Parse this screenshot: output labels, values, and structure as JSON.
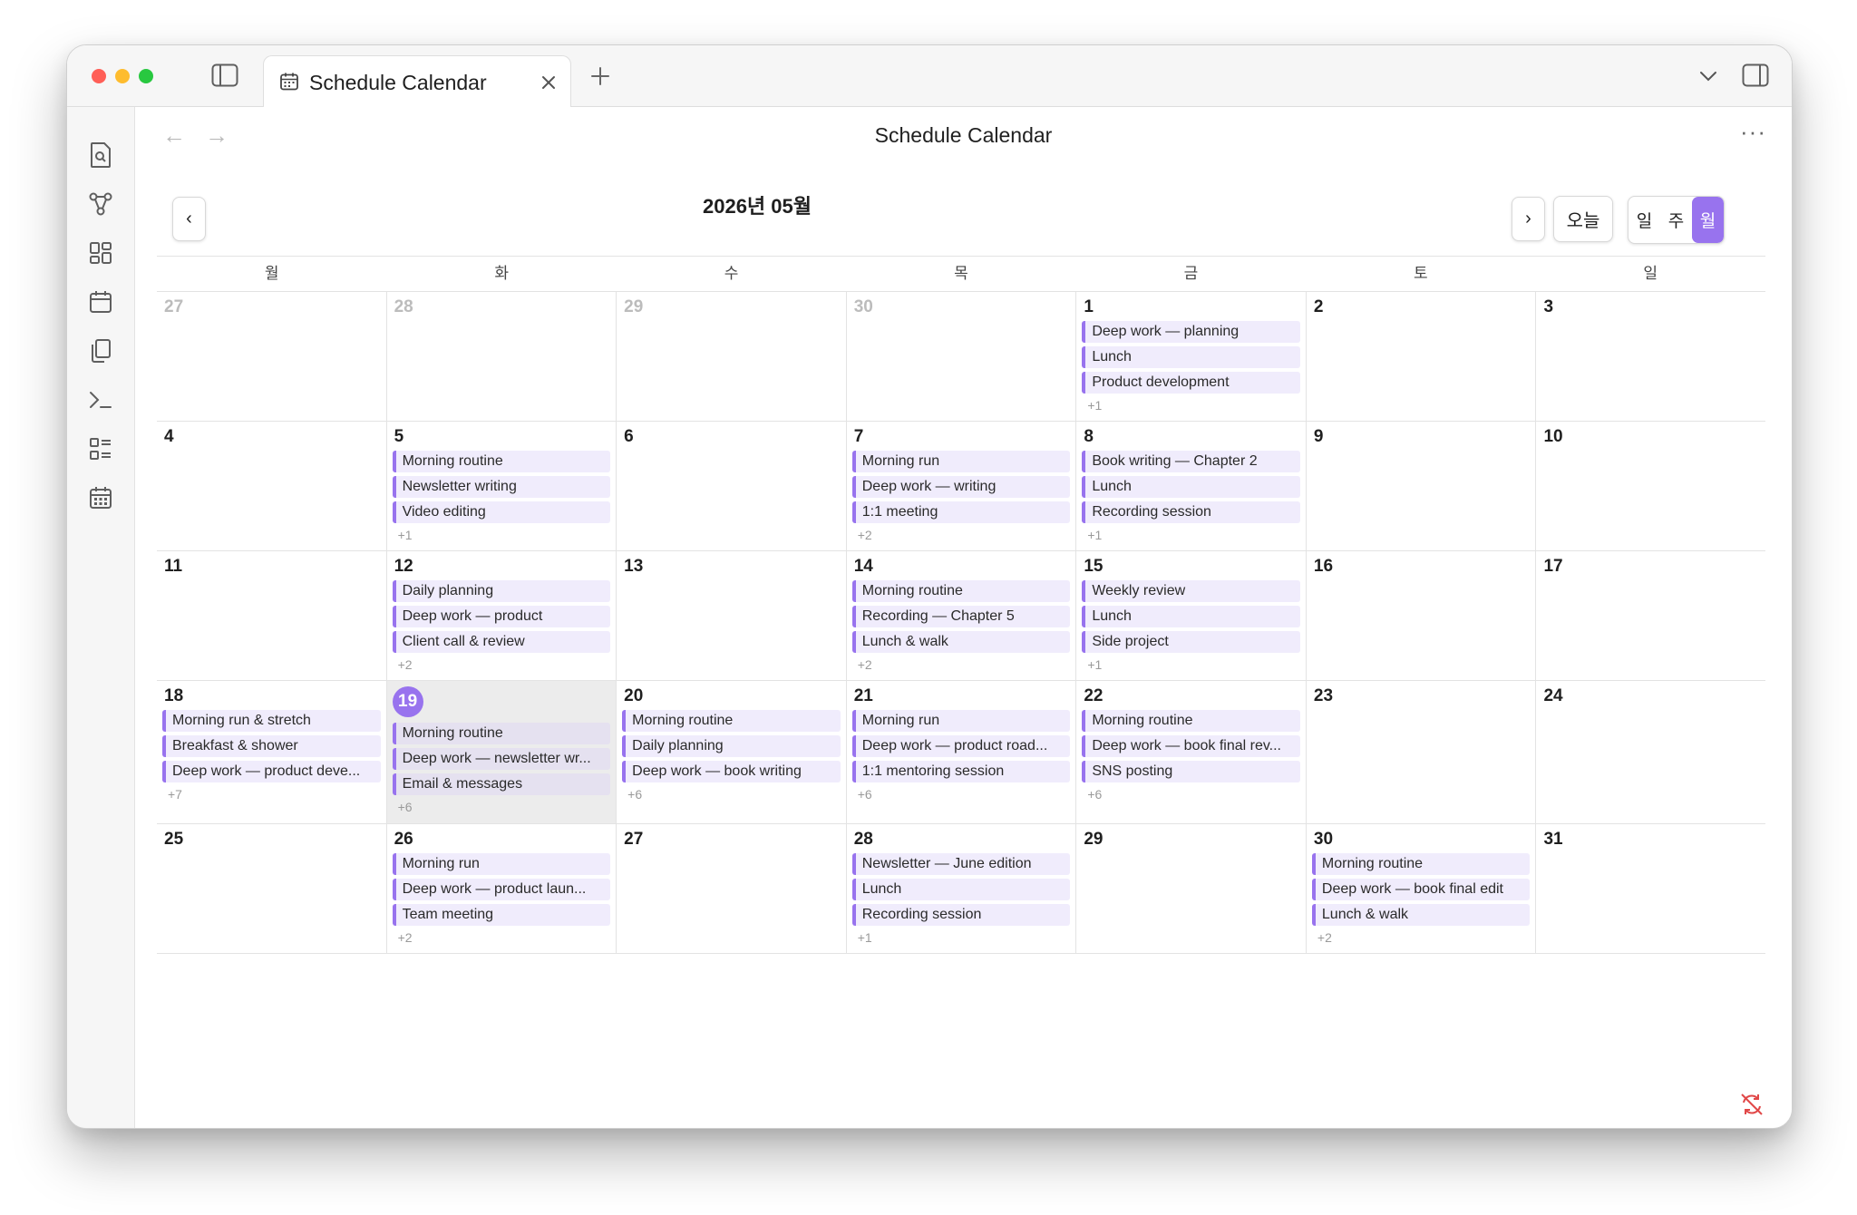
{
  "tab": {
    "title": "Schedule Calendar"
  },
  "page": {
    "title": "Schedule Calendar"
  },
  "calendar": {
    "month_label": "2026년 05월",
    "today_label": "오늘",
    "view_options": [
      "일",
      "주",
      "월"
    ],
    "active_view": "월",
    "accent_color": "#9873ee",
    "weekdays": [
      "월",
      "화",
      "수",
      "목",
      "금",
      "토",
      "일"
    ],
    "weeks": [
      [
        {
          "day": "27",
          "muted": true,
          "events": [],
          "more": ""
        },
        {
          "day": "28",
          "muted": true,
          "events": [],
          "more": ""
        },
        {
          "day": "29",
          "muted": true,
          "events": [],
          "more": ""
        },
        {
          "day": "30",
          "muted": true,
          "events": [],
          "more": ""
        },
        {
          "day": "1",
          "events": [
            "Deep work — planning",
            "Lunch",
            "Product development"
          ],
          "more": "+1"
        },
        {
          "day": "2",
          "events": [],
          "more": ""
        },
        {
          "day": "3",
          "events": [],
          "more": ""
        }
      ],
      [
        {
          "day": "4",
          "events": [],
          "more": ""
        },
        {
          "day": "5",
          "events": [
            "Morning routine",
            "Newsletter writing",
            "Video editing"
          ],
          "more": "+1"
        },
        {
          "day": "6",
          "events": [],
          "more": ""
        },
        {
          "day": "7",
          "events": [
            "Morning run",
            "Deep work — writing",
            "1:1 meeting"
          ],
          "more": "+2"
        },
        {
          "day": "8",
          "events": [
            "Book writing — Chapter 2",
            "Lunch",
            "Recording session"
          ],
          "more": "+1"
        },
        {
          "day": "9",
          "events": [],
          "more": ""
        },
        {
          "day": "10",
          "events": [],
          "more": ""
        }
      ],
      [
        {
          "day": "11",
          "events": [],
          "more": ""
        },
        {
          "day": "12",
          "events": [
            "Daily planning",
            "Deep work — product",
            "Client call & review"
          ],
          "more": "+2"
        },
        {
          "day": "13",
          "events": [],
          "more": ""
        },
        {
          "day": "14",
          "events": [
            "Morning routine",
            "Recording — Chapter 5",
            "Lunch & walk"
          ],
          "more": "+2"
        },
        {
          "day": "15",
          "events": [
            "Weekly review",
            "Lunch",
            "Side project"
          ],
          "more": "+1"
        },
        {
          "day": "16",
          "events": [],
          "more": ""
        },
        {
          "day": "17",
          "events": [],
          "more": ""
        }
      ],
      [
        {
          "day": "18",
          "events": [
            "Morning run & stretch",
            "Breakfast & shower",
            "Deep work — product deve..."
          ],
          "more": "+7"
        },
        {
          "day": "19",
          "today": true,
          "events": [
            "Morning routine",
            "Deep work — newsletter wr...",
            "Email & messages"
          ],
          "more": "+6"
        },
        {
          "day": "20",
          "events": [
            "Morning routine",
            "Daily planning",
            "Deep work — book writing"
          ],
          "more": "+6"
        },
        {
          "day": "21",
          "events": [
            "Morning run",
            "Deep work — product road...",
            "1:1 mentoring session"
          ],
          "more": "+6"
        },
        {
          "day": "22",
          "events": [
            "Morning routine",
            "Deep work — book final rev...",
            "SNS posting"
          ],
          "more": "+6"
        },
        {
          "day": "23",
          "events": [],
          "more": ""
        },
        {
          "day": "24",
          "events": [],
          "more": ""
        }
      ],
      [
        {
          "day": "25",
          "events": [],
          "more": ""
        },
        {
          "day": "26",
          "events": [
            "Morning run",
            "Deep work — product laun...",
            "Team meeting"
          ],
          "more": "+2"
        },
        {
          "day": "27",
          "events": [],
          "more": ""
        },
        {
          "day": "28",
          "events": [
            "Newsletter — June edition",
            "Lunch",
            "Recording session"
          ],
          "more": "+1"
        },
        {
          "day": "29",
          "events": [],
          "more": ""
        },
        {
          "day": "30",
          "events": [
            "Morning routine",
            "Deep work — book final edit",
            "Lunch & walk"
          ],
          "more": "+2"
        },
        {
          "day": "31",
          "events": [],
          "more": ""
        }
      ]
    ]
  }
}
